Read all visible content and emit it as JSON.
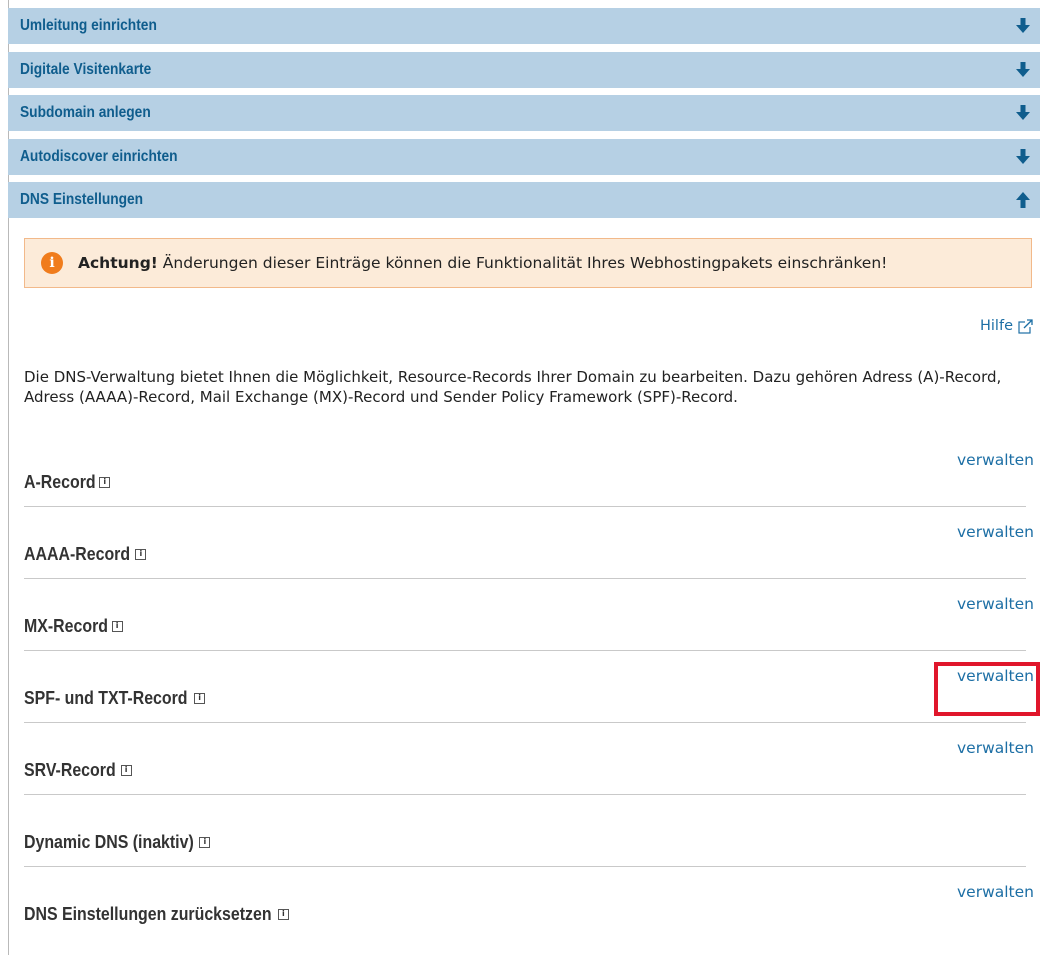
{
  "accordion": [
    {
      "title": "Umleitung einrichten",
      "state": "collapsed"
    },
    {
      "title": "Digitale Visitenkarte",
      "state": "collapsed"
    },
    {
      "title": "Subdomain anlegen",
      "state": "collapsed"
    },
    {
      "title": "Autodiscover einrichten",
      "state": "collapsed"
    },
    {
      "title": "DNS Einstellungen",
      "state": "expanded"
    }
  ],
  "alert": {
    "icon": "info-icon",
    "strong": "Achtung!",
    "text": " Änderungen dieser Einträge können die Funktionalität Ihres Webhostingpakets einschränken!"
  },
  "help": {
    "label": "Hilfe",
    "icon": "external-link-icon"
  },
  "intro": "Die DNS-Verwaltung bietet Ihnen die Möglichkeit, Resource-Records Ihrer Domain zu bearbeiten. Dazu gehören Adress (A)-Record, Adress (AAAA)-Record, Mail Exchange (MX)-Record und Sender Policy Framework (SPF)-Record.",
  "records": [
    {
      "label": "A-Record",
      "action": "verwalten"
    },
    {
      "label": "AAAA-Record",
      "action": "verwalten"
    },
    {
      "label": "MX-Record",
      "action": "verwalten"
    },
    {
      "label": "SPF- und TXT-Record",
      "action": "verwalten"
    },
    {
      "label": "SRV-Record",
      "action": "verwalten"
    },
    {
      "label": "Dynamic DNS (inaktiv)",
      "action": ""
    },
    {
      "label": "DNS Einstellungen zurücksetzen",
      "action": "verwalten"
    }
  ],
  "colors": {
    "accordion_bg": "#b6d0e4",
    "accordion_text": "#0f5d8d",
    "link": "#1d6fa5",
    "alert_bg": "#fcebd9",
    "alert_border": "#f2b98a",
    "alert_icon": "#f07c1c",
    "highlight": "#e0162b"
  },
  "info_glyph": "i"
}
